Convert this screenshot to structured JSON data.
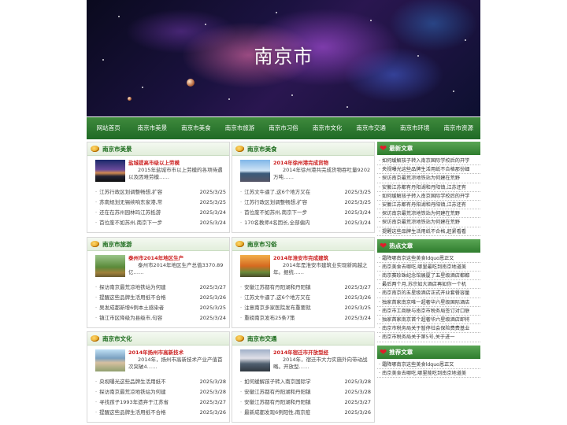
{
  "banner": {
    "title": "南京市"
  },
  "nav": [
    "网站首页",
    "南京市美景",
    "南京市美食",
    "南京市旅游",
    "南京市习俗",
    "南京市文化",
    "南京市交通",
    "南京市环境",
    "南京市资源"
  ],
  "sections": [
    {
      "title": "南京市美景",
      "thumb": "city",
      "feature_title": "盐城提高市级以上劳模",
      "feature_desc": "2015年盐城市市以上劳模的各项待遇以及因难劳模……",
      "items": [
        {
          "t": "江苏行政区划调整畅想,扩容",
          "d": "2025/3/25"
        },
        {
          "t": "苏南规划无锡续响东家港,常",
          "d": "2025/3/25"
        },
        {
          "t": "还在在苏州园林玛江苏抵游",
          "d": "2025/3/24"
        },
        {
          "t": "首位废不如苏州,南京下一步",
          "d": "2025/3/24"
        }
      ]
    },
    {
      "title": "南京市美食",
      "thumb": "port",
      "feature_title": "2014年徐州港完成货物",
      "feature_desc": "2014年徐州港共完成货物吞吐量9202万吨……",
      "items": [
        {
          "t": "江苏文牛逼了,这6个地方又在",
          "d": "2025/3/25"
        },
        {
          "t": "江苏行政区划调整畅想,扩容",
          "d": "2025/3/25"
        },
        {
          "t": "首位废不如苏州,南京下一步",
          "d": "2025/3/24"
        },
        {
          "t": "170名教师4名因长,全部偏内",
          "d": "2025/3/24"
        }
      ]
    },
    {
      "title": "南京市旅游",
      "thumb": "farm",
      "feature_title": "泰州市2014年地区生产",
      "feature_desc": "泰州市2014年地区生产总值3370.89亿……",
      "items": [
        {
          "t": "探访南京最荒凉地铁站为何建",
          "d": "2025/3/27"
        },
        {
          "t": "提醒这些品牌生活用纸不合格",
          "d": "2025/3/26"
        },
        {
          "t": "吴发成都新增6例本土感染者",
          "d": "2025/3/25"
        },
        {
          "t": "镇江市区降级为县级市,句容",
          "d": "2025/3/24"
        }
      ]
    },
    {
      "title": "南京市习俗",
      "thumb": "autumn",
      "feature_title": "2014年淮安市完成建筑",
      "feature_desc": "2014年是淮安市建筑业实现新跨越之年。据统……",
      "items": [
        {
          "t": "安徽江苏都有丹阳湖和丹阳镇",
          "d": "2025/3/27"
        },
        {
          "t": "江苏文牛逼了,这6个地方又在",
          "d": "2025/3/26"
        },
        {
          "t": "注意南京多家医院发布重要就",
          "d": "2025/3/25"
        },
        {
          "t": "重磅南京发布25条7策",
          "d": "2025/3/24"
        }
      ]
    },
    {
      "title": "南京市文化",
      "thumb": "park",
      "feature_title": "2014年扬州市高新技术",
      "feature_desc": "2014年，扬州市高新技术产业产值首次突破4……",
      "items": [
        {
          "t": "央视曝光这些品牌生活用纸不",
          "d": "2025/3/28"
        },
        {
          "t": "探访南京最荒凉地铁站为何建",
          "d": "2025/3/28"
        },
        {
          "t": "寻找孩子1993年遗弃于江苏省",
          "d": "2025/3/27"
        },
        {
          "t": "提醒这些品牌生活用纸不合格",
          "d": "2025/3/26"
        }
      ]
    },
    {
      "title": "南京市交通",
      "thumb": "cloud",
      "feature_title": "2014年宿迁市开放型经",
      "feature_desc": "2014年，宿迁市大力实施外向带动战略。开放型……",
      "items": [
        {
          "t": "如何缓解孩子转入南京国际学",
          "d": "2025/3/28"
        },
        {
          "t": "安徽江苏都有丹阳湖和丹阳镇",
          "d": "2025/3/28"
        },
        {
          "t": "安徽江苏都有丹阳湖和丹阳镇",
          "d": "2025/3/27"
        },
        {
          "t": "最新成都发现6例阳性,南京疫",
          "d": "2025/3/26"
        }
      ]
    }
  ],
  "sidebar": [
    {
      "title": "最新文章",
      "items": [
        "如何缓解孩子转入南京国际学校后的开学",
        "央视曝光这些品牌生活用纸不合格那份细",
        "探访南京最荒凉地铁站为何建在荒野",
        "安徽江苏都有丹阳湖和丹阳镇,江苏还有",
        "如何缓解孩子转入南京国际学校后的开学",
        "安徽江苏都有丹阳湖和丹阳镇,江苏还有",
        "探访南京最荒凉地铁站为何建在荒野",
        "探访南京最荒凉地铁站为何建在荒野",
        "提醒这些品牌生活用纸不合格,赶紧看看"
      ]
    },
    {
      "title": "热点文章",
      "items": [
        "霜降哪南京这些美食ldquo恩正又",
        "南京美食去哪吃,哪里最吃到南京地道美",
        "南京赛珍珠纪念馆展厦了五星级酒店都都",
        "最后两个月,苏宗如大酒店再如你一个机",
        "南京南京的五星级酒店正式开业套餐容量",
        "独家首家南京唯一超奢华六星级国际酒店",
        "南京市工商联与南京市税务局签订对口联",
        "独家首家南京首个超奢华六星级酒店即将",
        "南京市税务局关于暂停社会保险费费基业",
        "南京市税务局关于第5号,关于进一"
      ]
    },
    {
      "title": "推荐文章",
      "items": [
        "霜降哪南京这些美食ldquo恩正又",
        "南京美食去哪吃,哪里能吃到南京地道美"
      ]
    }
  ]
}
